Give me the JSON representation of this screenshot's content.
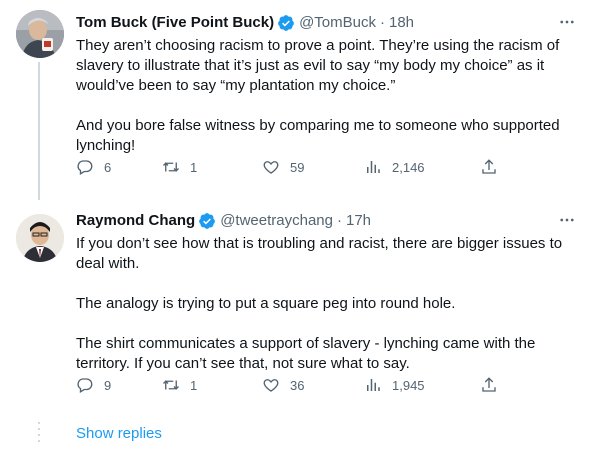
{
  "colors": {
    "accent": "#1d9bf0",
    "verified": "#1d9bf0",
    "text": "#0f1419",
    "secondary": "#536471",
    "line": "#cfd9de"
  },
  "tweets": [
    {
      "author": "Tom Buck (Five Point Buck)",
      "handle": "@TomBuck",
      "separator": "·",
      "time": "18h",
      "verified_icon": "verified-badge-icon",
      "paragraphs": [
        "They aren’t choosing racism to prove a point. They’re using the racism of slavery to illustrate that it’s just as evil to say “my body my choice” as it would’ve been to say “my plantation my choice.”",
        "And you bore false witness by comparing me to someone who supported lynching!"
      ],
      "stats": {
        "replies": "6",
        "retweets": "1",
        "likes": "59",
        "views": "2,146"
      }
    },
    {
      "author": "Raymond Chang",
      "handle": "@tweetraychang",
      "separator": "·",
      "time": "17h",
      "verified_icon": "verified-badge-icon",
      "paragraphs": [
        "If you don’t see how that is troubling and racist, there are bigger issues to deal with.",
        "The analogy is trying to put a square peg into round hole.",
        "The shirt communicates a support of slavery - lynching came with the territory. If you can’t see that, not sure what to say."
      ],
      "stats": {
        "replies": "9",
        "retweets": "1",
        "likes": "36",
        "views": "1,945"
      }
    }
  ],
  "show_replies_label": "Show replies"
}
